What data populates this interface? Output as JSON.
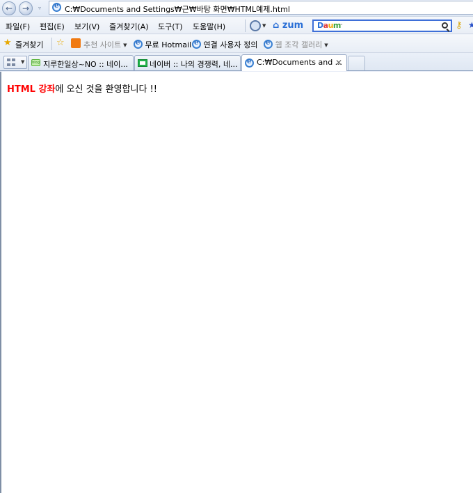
{
  "address": {
    "url": "C:₩Documents and Settings₩근₩바탕 화면₩HTML예제.html"
  },
  "menu": [
    {
      "label": "파일(F)"
    },
    {
      "label": "편집(E)"
    },
    {
      "label": "보기(V)"
    },
    {
      "label": "즐겨찾기(A)"
    },
    {
      "label": "도구(T)"
    },
    {
      "label": "도움말(H)"
    }
  ],
  "toolbar": {
    "zum_logo": "zum",
    "search_provider": "Daum",
    "search_placeholder": "-"
  },
  "favorites_bar": {
    "favorites_label": "즐겨찾기",
    "recommended_sites": "추천 사이트",
    "free_hotmail": "무료 Hotmail",
    "custom_links": "연결 사용자 정의",
    "web_slice_gallery": "웹 조각 갤러리"
  },
  "tabs": [
    {
      "label": "지루한일상~NO :: 네이..."
    },
    {
      "label": "네이버 :: 나의 경쟁력, 네..."
    },
    {
      "label": "C:₩Documents and ..."
    }
  ],
  "page": {
    "highlight": "HTML 강좌",
    "rest": "에 오신 것을 환영합니다 !!"
  }
}
